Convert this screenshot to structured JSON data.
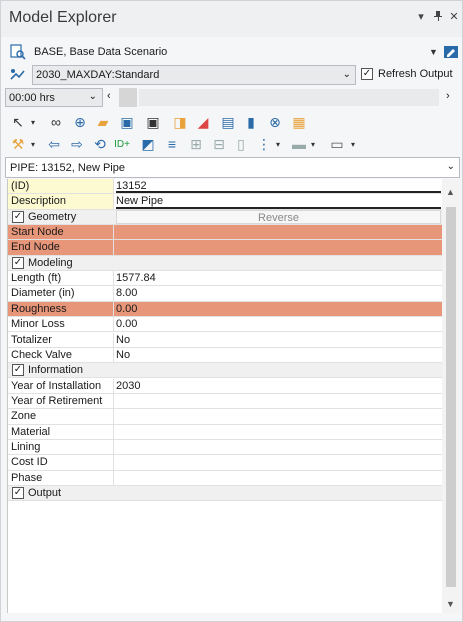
{
  "window": {
    "title": "Model Explorer",
    "dropdown_glyph": "▾",
    "pin_glyph": "ᵖ",
    "close_glyph": "✕"
  },
  "scenario": {
    "value": "BASE, Base Data Scenario"
  },
  "alternative": {
    "value": "2030_MAXDAY:Standard",
    "refresh_label": "Refresh Output",
    "refresh_checked": true
  },
  "time": {
    "value": "00:00 hrs"
  },
  "selector": {
    "value": "PIPE: 13152, New Pipe"
  },
  "properties": {
    "rows": [
      {
        "key": "(ID)",
        "value": "13152",
        "style": "yellow"
      },
      {
        "key": "Description",
        "value": "New Pipe",
        "style": "yellow"
      },
      {
        "key": "Geometry",
        "value": "Reverse",
        "style": "section"
      },
      {
        "key": "Start Node",
        "value": "",
        "style": "highlight"
      },
      {
        "key": "End Node",
        "value": "",
        "style": "highlight"
      },
      {
        "key": "Modeling",
        "value": "",
        "style": "section"
      },
      {
        "key": "Length (ft)",
        "value": "1577.84",
        "style": ""
      },
      {
        "key": "Diameter (in)",
        "value": "8.00",
        "style": ""
      },
      {
        "key": "Roughness",
        "value": "0.00",
        "style": "highlight"
      },
      {
        "key": "Minor Loss",
        "value": "0.00",
        "style": ""
      },
      {
        "key": "Totalizer",
        "value": "No",
        "style": ""
      },
      {
        "key": "Check Valve",
        "value": "No",
        "style": ""
      },
      {
        "key": "Information",
        "value": "",
        "style": "section"
      },
      {
        "key": "Year of Installation",
        "value": "2030",
        "style": ""
      },
      {
        "key": "Year of Retirement",
        "value": "",
        "style": ""
      },
      {
        "key": "Zone",
        "value": "",
        "style": ""
      },
      {
        "key": "Material",
        "value": "",
        "style": ""
      },
      {
        "key": "Lining",
        "value": "",
        "style": ""
      },
      {
        "key": "Cost ID",
        "value": "",
        "style": ""
      },
      {
        "key": "Phase",
        "value": "",
        "style": ""
      },
      {
        "key": "Output",
        "value": "",
        "style": "section"
      }
    ]
  },
  "colors": {
    "highlight": "#e8967a",
    "yellow": "#fdfad2",
    "accent": "#1e73be"
  }
}
